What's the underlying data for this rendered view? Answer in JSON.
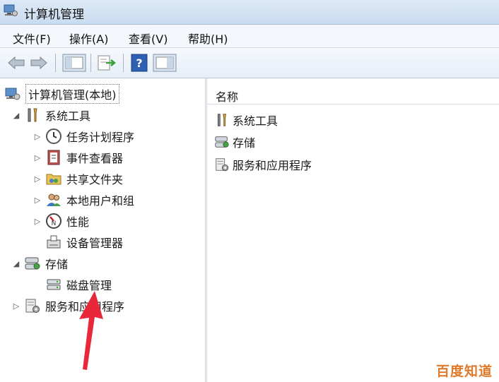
{
  "window": {
    "title": "计算机管理"
  },
  "menu": [
    "文件(F)",
    "操作(A)",
    "查看(V)",
    "帮助(H)"
  ],
  "toolbar": {
    "buttons": [
      "back-icon",
      "forward-icon",
      "console-tree-icon",
      "export-icon",
      "help-icon",
      "action-pane-icon"
    ]
  },
  "tree": {
    "root": "计算机管理(本地)",
    "system_tools": "系统工具",
    "task_scheduler": "任务计划程序",
    "event_viewer": "事件查看器",
    "shared_folders": "共享文件夹",
    "local_users": "本地用户和组",
    "performance": "性能",
    "device_manager": "设备管理器",
    "storage": "存储",
    "disk_management": "磁盘管理",
    "services_apps": "服务和应用程序"
  },
  "list": {
    "header": "名称",
    "items": [
      "系统工具",
      "存储",
      "服务和应用程序"
    ]
  },
  "watermark": "百度知道",
  "colors": {
    "arrow": "#e8283a",
    "watermark": "#e07a2a"
  }
}
